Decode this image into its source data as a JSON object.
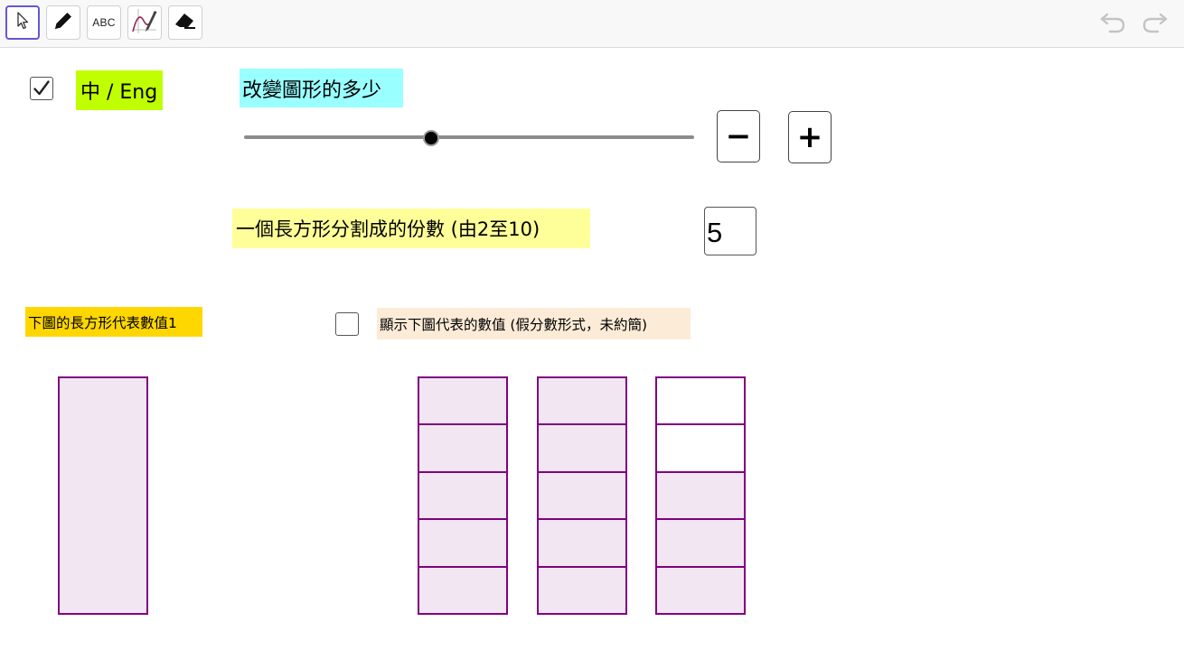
{
  "toolbar": {
    "tools": [
      {
        "name": "move-tool",
        "icon": "cursor-arrow-icon",
        "active": true
      },
      {
        "name": "pen-tool",
        "icon": "pencil-icon",
        "active": false
      },
      {
        "name": "text-tool",
        "icon": "abc-text-icon",
        "label": "ABC",
        "active": false
      },
      {
        "name": "function-inspector-tool",
        "icon": "graph-pencil-icon",
        "active": false
      },
      {
        "name": "eraser-tool",
        "icon": "eraser-icon",
        "active": false
      }
    ],
    "undo_icon": "undo-icon",
    "redo_icon": "redo-icon"
  },
  "language_toggle": {
    "checked": true,
    "label": "中 / Eng",
    "color": "#c0ff00"
  },
  "slider_section": {
    "title": "改變圖形的多少",
    "title_color": "#99ffff",
    "value_fraction": 0.415
  },
  "buttons": {
    "minus": "−",
    "plus": "+"
  },
  "partition": {
    "label": "一個長方形分割成的份數 (由2至10)",
    "label_color": "#ffff99",
    "value": "5"
  },
  "unit_label": {
    "text": "下圖的長方形代表數值1",
    "color": "#ffd700"
  },
  "show_value": {
    "checked": false,
    "label": "顯示下圖代表的數值 (假分數形式，未約簡)",
    "label_color": "#fcebd7"
  },
  "colors": {
    "bar_border": "#800080",
    "bar_fill": "#f2e6f2"
  },
  "model": {
    "unit_bar_filled": true,
    "bars": [
      {
        "parts": 5,
        "filled": 5
      },
      {
        "parts": 5,
        "filled": 5
      },
      {
        "parts": 5,
        "filled": 3
      }
    ]
  }
}
